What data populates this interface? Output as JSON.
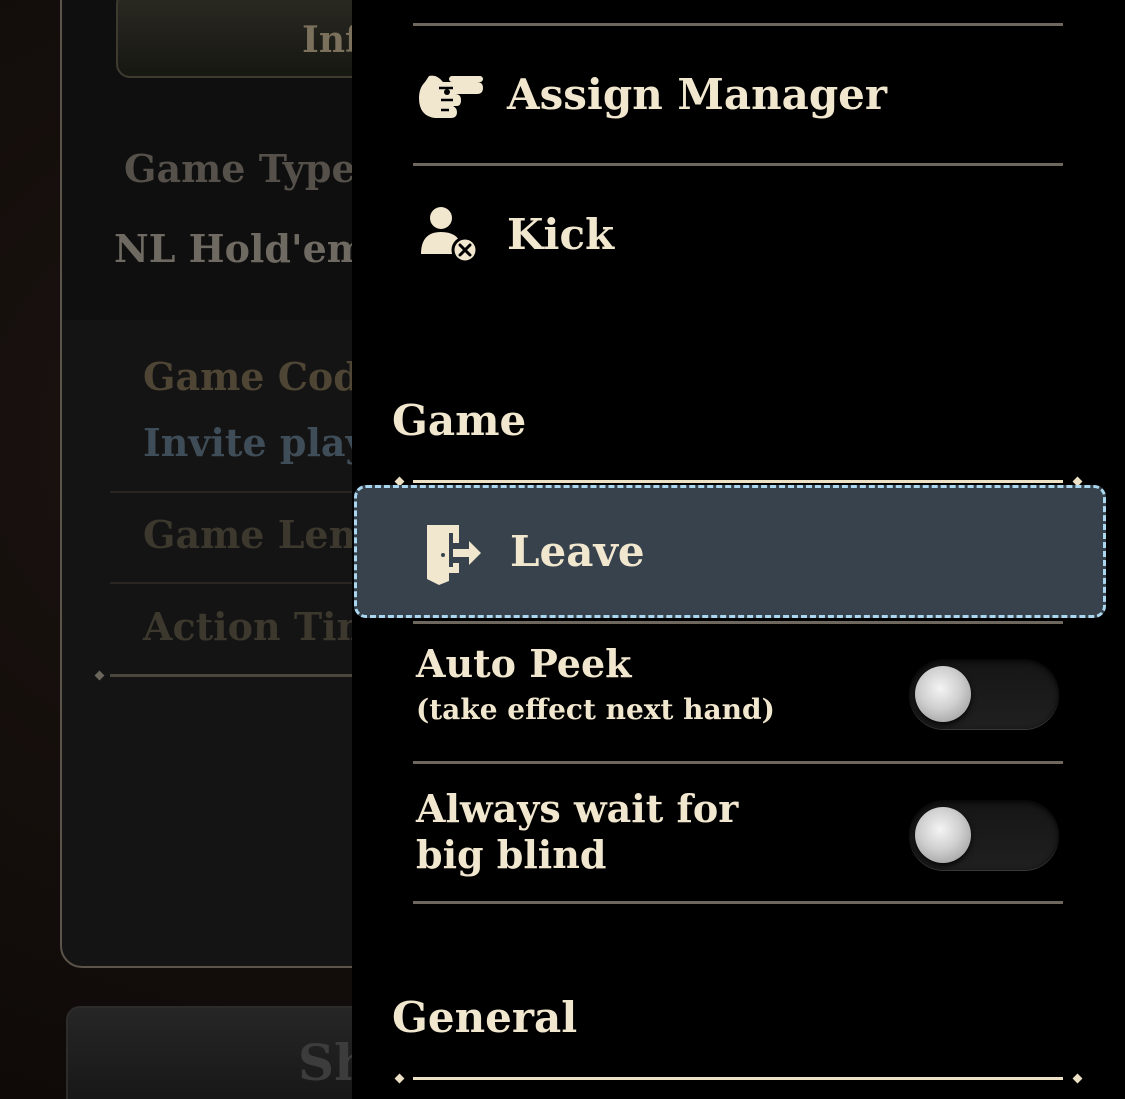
{
  "background_panel": {
    "info_tab_label": "Inf",
    "game_type_label": "Game Type",
    "game_type_value": "NL Hold'em",
    "game_code_label": "Game Code",
    "invite_link_text": "Invite playe",
    "game_length_label": "Game Leng",
    "action_time_label": "Action Tim",
    "share_button_label": "Sh"
  },
  "menu": {
    "player_actions": [
      {
        "label": "Assign Manager",
        "icon": "pointing-hand-icon"
      },
      {
        "label": "Kick",
        "icon": "user-remove-icon"
      }
    ],
    "game_section": {
      "title": "Game",
      "leave": {
        "label": "Leave",
        "icon": "exit-door-icon"
      },
      "toggles": [
        {
          "title": "Auto Peek",
          "subtitle": "(take effect next hand)",
          "on": false
        },
        {
          "title_line1": "Always wait for",
          "title_line2": "big blind",
          "on": false
        }
      ]
    },
    "general_section": {
      "title": "General"
    }
  },
  "colors": {
    "menu_text": "#f1e7cf",
    "menu_background": "#000000",
    "selected_item_background": "#37424d",
    "selected_item_border": "#aad6ef",
    "divider": "#6d675e"
  }
}
